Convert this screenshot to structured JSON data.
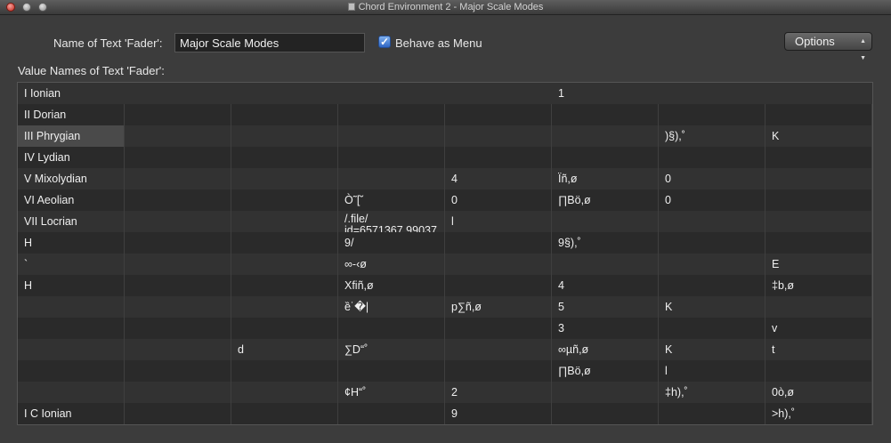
{
  "window": {
    "title": "Chord Environment 2 - Major Scale Modes"
  },
  "form": {
    "name_label": "Name of Text 'Fader':",
    "name_value": "Major Scale Modes",
    "behave_label": "Behave as Menu",
    "behave_checked": true,
    "options_label": "Options",
    "values_label": "Value Names of Text 'Fader':"
  },
  "grid": {
    "rows": [
      [
        "I   Ionian",
        "",
        "",
        "",
        "",
        "1",
        "",
        ""
      ],
      [
        "II  Dorian",
        "",
        "",
        "",
        "",
        "",
        "",
        ""
      ],
      [
        "III Phrygian",
        "",
        "",
        "",
        "",
        "",
        ")§),˚",
        "K"
      ],
      [
        "IV Lydian",
        "",
        "",
        "",
        "",
        "",
        "",
        ""
      ],
      [
        "V  Mixolydian",
        "",
        "",
        "",
        "4",
        "Ïñ,ø",
        "0",
        ""
      ],
      [
        "VI Aeolian",
        "",
        "",
        " Ò˜[˘",
        "0",
        "∏Bö,ø",
        "0",
        ""
      ],
      [
        "VII Locrian",
        "",
        "",
        "/.file/\nid=6571367.99037",
        "l",
        "",
        "",
        ""
      ],
      [
        "H",
        "",
        "",
        "9/",
        "",
        "9§),˚",
        "",
        ""
      ],
      [
        "`",
        "",
        "",
        "∞-‹ø",
        "",
        "",
        "",
        "E"
      ],
      [
        "H",
        "",
        "",
        "Xfiñ,ø",
        "",
        "4",
        "",
        "‡b,ø"
      ],
      [
        "",
        "",
        "",
        "ȅ˙�|",
        "p∑ñ,ø",
        "5",
        "K",
        ""
      ],
      [
        "",
        "",
        "",
        "",
        "",
        "3",
        "",
        "v"
      ],
      [
        "",
        "",
        "d",
        "∑D“˚",
        "",
        "∞µñ,ø",
        "K",
        "t"
      ],
      [
        "",
        "",
        "",
        "",
        "",
        "∏Bö,ø",
        "l",
        ""
      ],
      [
        "",
        "",
        "",
        "¢H“˚",
        "2",
        "",
        "‡h),˚",
        "0ò,ø"
      ],
      [
        "I  C Ionian",
        "",
        "",
        "",
        "9",
        "",
        "",
        ">h),˚"
      ]
    ],
    "selected": {
      "row": 2,
      "col": 0
    }
  }
}
